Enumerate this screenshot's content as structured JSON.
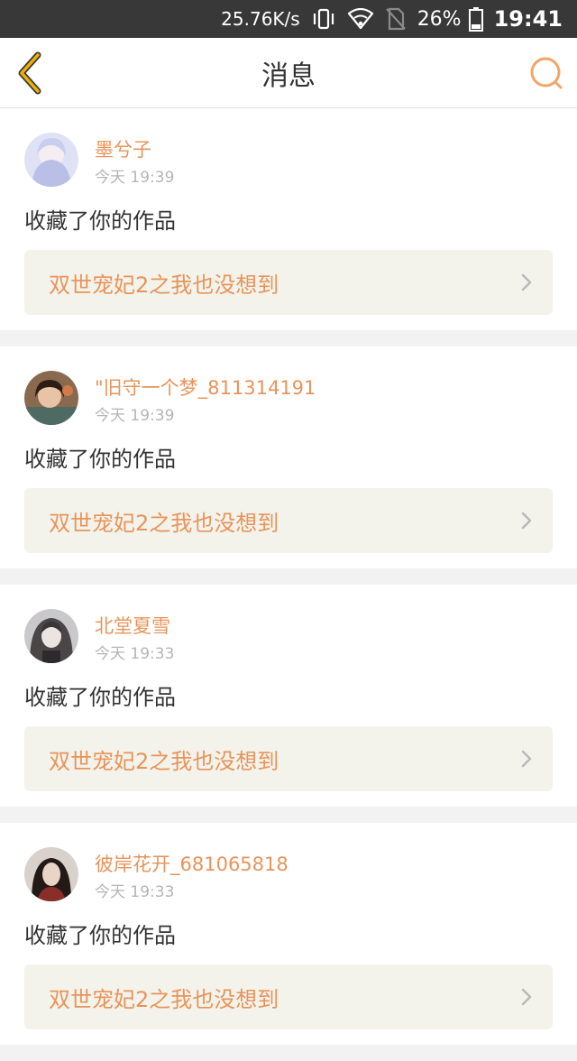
{
  "status_bar": {
    "net_speed": "25.76K/s",
    "battery": "26%",
    "time": "19:41",
    "icons": [
      "vibrate-icon",
      "wifi-icon",
      "no-sim-icon",
      "battery-icon"
    ]
  },
  "header": {
    "title": "消息",
    "back_icon": "chevron-left-icon",
    "search_icon": "search-icon",
    "accent_color": "#f0b000",
    "search_color": "#f3a567"
  },
  "messages": [
    {
      "username": "墨兮子",
      "time": "今天 19:39",
      "action": "收藏了你的作品",
      "work": "双世宠妃2之我也没想到",
      "avatar_color": "#b9bfe6"
    },
    {
      "username": "\"旧守一个梦_811314191",
      "time": "今天 19:39",
      "action": "收藏了你的作品",
      "work": "双世宠妃2之我也没想到",
      "avatar_color": "#7a5a40"
    },
    {
      "username": "北堂夏雪",
      "time": "今天 19:33",
      "action": "收藏了你的作品",
      "work": "双世宠妃2之我也没想到",
      "avatar_color": "#7d7d80"
    },
    {
      "username": "彼岸花开_681065818",
      "time": "今天 19:33",
      "action": "收藏了你的作品",
      "work": "双世宠妃2之我也没想到",
      "avatar_color": "#5a3a36"
    }
  ]
}
